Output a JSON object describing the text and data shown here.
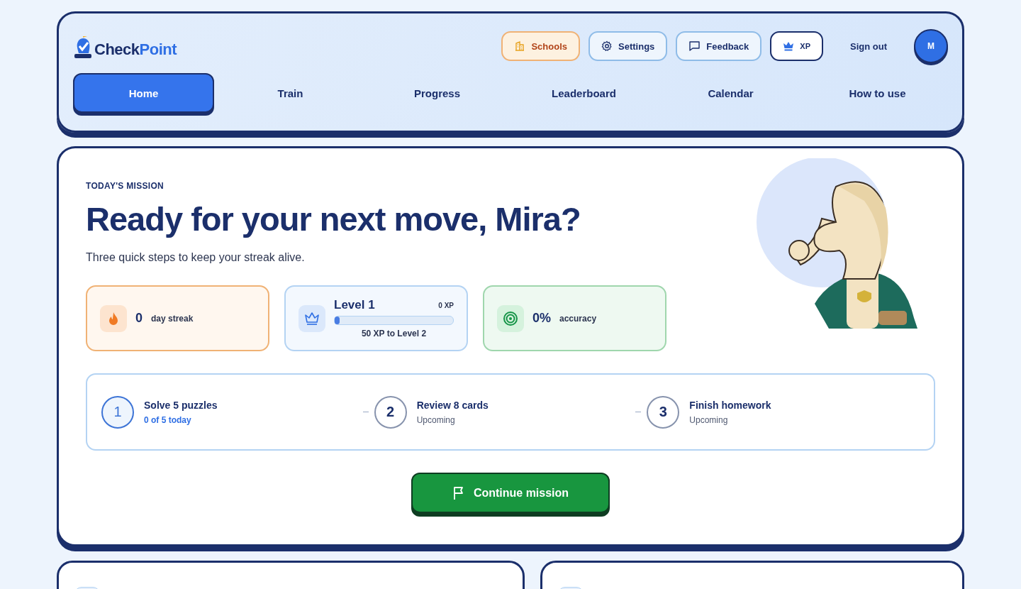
{
  "header": {
    "logo": [
      "Check",
      "Point"
    ],
    "actions": [
      {
        "kind": "warm",
        "label": "Schools"
      },
      {
        "kind": "plain",
        "label": "Settings"
      },
      {
        "kind": "plain",
        "label": "Feedback"
      },
      {
        "kind": "dark",
        "label": "XP"
      },
      {
        "kind": "link",
        "label": "Sign out"
      }
    ],
    "avatar": "M",
    "tabs": [
      {
        "label": "Home",
        "selected": true
      },
      {
        "label": "Train",
        "selected": false
      },
      {
        "label": "Progress",
        "selected": false
      },
      {
        "label": "Leaderboard",
        "selected": false
      },
      {
        "label": "Calendar",
        "selected": false
      },
      {
        "label": "How to use",
        "selected": false
      }
    ]
  },
  "mission": {
    "eyebrow": "TODAY'S MISSION",
    "title": "Ready for your next move, Mira?",
    "subtitle": "Three quick steps to keep your streak alive.",
    "stats": [
      {
        "kind": "streak",
        "value": "0",
        "label": "day streak"
      },
      {
        "kind": "level",
        "title": "Level 1",
        "xp": "0 XP",
        "level": 0.02,
        "note": "50 XP to Level 2"
      },
      {
        "kind": "accuracy",
        "value": "0%",
        "label": "accuracy"
      }
    ],
    "steps": [
      {
        "number": "1",
        "title": "Solve 5 puzzles",
        "status": "0 of 5 today",
        "active": true
      },
      {
        "number": "2",
        "title": "Review 8 cards",
        "status": "Upcoming",
        "active": false
      },
      {
        "number": "3",
        "title": "Finish homework",
        "status": "Upcoming",
        "active": false
      }
    ],
    "button": "Continue mission"
  }
}
